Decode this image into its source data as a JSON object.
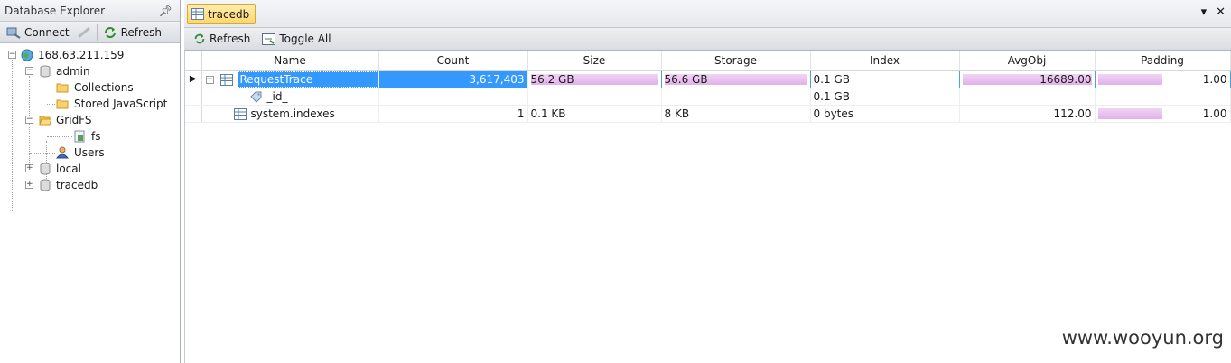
{
  "left_panel": {
    "title": "Database Explorer",
    "toolbar": {
      "connect_label": "Connect",
      "refresh_label": "Refresh"
    },
    "tree": {
      "server": "168.63.211.159",
      "admin": "admin",
      "collections": "Collections",
      "stored_js": "Stored JavaScript",
      "gridfs": "GridFS",
      "fs": "fs",
      "users": "Users",
      "local": "local",
      "tracedb": "tracedb"
    }
  },
  "right_panel": {
    "tab_label": "tracedb",
    "toolbar": {
      "refresh_label": "Refresh",
      "toggle_label": "Toggle All"
    },
    "columns": [
      "Name",
      "Count",
      "Size",
      "Storage",
      "Index",
      "AvgObj",
      "Padding"
    ],
    "rows": [
      {
        "name": "RequestTrace",
        "count": "3,617,403",
        "size": "56.2 GB",
        "storage": "56.6 GB",
        "index": "0.1 GB",
        "avgobj": "16689.00",
        "padding": "1.00",
        "size_fill": 1.0,
        "storage_fill": 1.0,
        "avgobj_fill": 1.0,
        "padding_fill": 0.5
      },
      {
        "name": "_id_",
        "count": "",
        "size": "",
        "storage": "",
        "index": "0.1 GB",
        "avgobj": "",
        "padding": ""
      },
      {
        "name": "system.indexes",
        "count": "1",
        "size": "0.1 KB",
        "storage": "8 KB",
        "index": "0 bytes",
        "avgobj": "112.00",
        "padding": "1.00",
        "padding_fill": 0.5
      }
    ]
  },
  "watermark": "www.wooyun.org",
  "colors": {
    "selection": "#3399ff",
    "bar": "#e1b0ea",
    "tab": "#ffd66b"
  }
}
